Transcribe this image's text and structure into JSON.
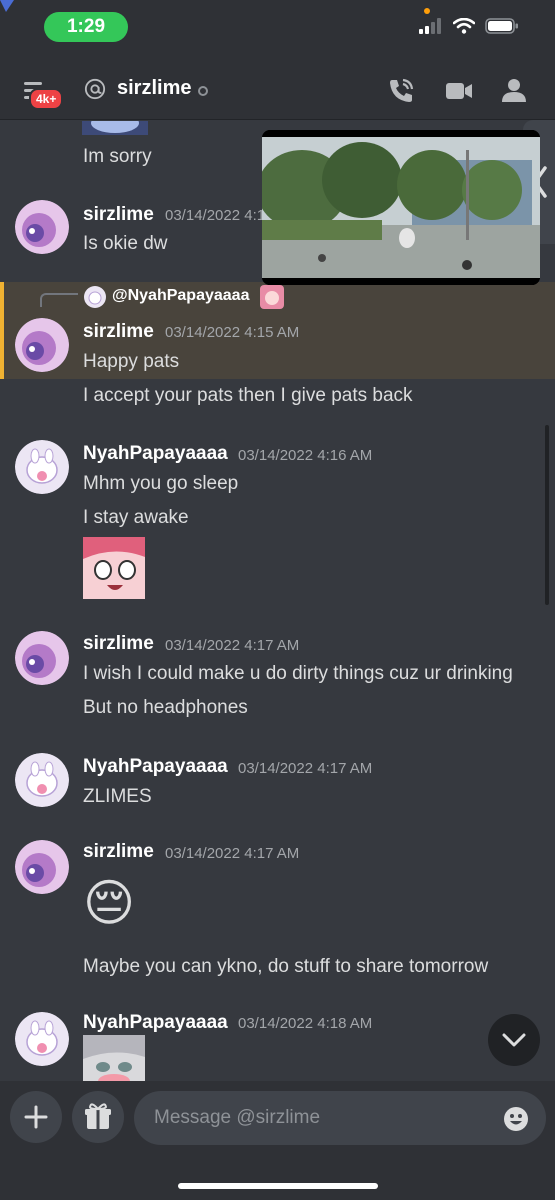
{
  "status_bar": {
    "time": "1:29"
  },
  "header": {
    "badge": "4k+",
    "title": "sirzlime"
  },
  "messages": [
    {
      "id": "m0",
      "text": "Im sorry"
    },
    {
      "id": "m1",
      "author": "sirzlime",
      "timestamp": "03/14/2022 4:15 AM",
      "lines": [
        "Is okie dw"
      ]
    },
    {
      "id": "m2",
      "reply_to": "@NyahPapayaaaa",
      "author": "sirzlime",
      "timestamp": "03/14/2022 4:15 AM",
      "lines": [
        "Happy pats",
        "I accept your pats then I give pats back"
      ]
    },
    {
      "id": "m3",
      "author": "NyahPapayaaaa",
      "timestamp": "03/14/2022 4:16 AM",
      "lines": [
        "Mhm you go sleep",
        "I stay awake"
      ],
      "sticker": "anime-girl-sticker"
    },
    {
      "id": "m4",
      "author": "sirzlime",
      "timestamp": "03/14/2022 4:17 AM",
      "lines": [
        "I wish I could make u do dirty things cuz ur drinking",
        "But no headphones"
      ]
    },
    {
      "id": "m5",
      "author": "NyahPapayaaaa",
      "timestamp": "03/14/2022 4:17 AM",
      "lines": [
        "ZLIMES"
      ]
    },
    {
      "id": "m6",
      "author": "sirzlime",
      "timestamp": "03/14/2022 4:17 AM",
      "emoji": "😔",
      "lines": [
        "Maybe you can ykno, do stuff to share tomorrow"
      ]
    },
    {
      "id": "m7",
      "author": "NyahPapayaaaa",
      "timestamp": "03/14/2022 4:18 AM",
      "sticker": "blushing-girl-sticker"
    }
  ],
  "composer": {
    "placeholder": "Message @sirzlime"
  },
  "colors": {
    "background": "#36393f",
    "header": "#2f3136",
    "reply_highlight": "#49443c",
    "reply_accent": "#f0b232",
    "status_pill": "#34c759",
    "badge": "#ed4245"
  },
  "icons": [
    "hamburger-icon",
    "at-icon",
    "call-icon",
    "video-icon",
    "members-icon",
    "chevron-left-icon",
    "plus-icon",
    "gift-icon",
    "emoji-icon",
    "chevron-down-icon"
  ]
}
